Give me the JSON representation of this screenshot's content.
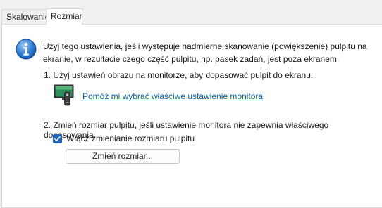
{
  "tabs": [
    {
      "label": "Skalowanie",
      "selected": false
    },
    {
      "label": "Rozmiar",
      "selected": true
    }
  ],
  "intro": {
    "line1": "Użyj tego ustawienia, jeśli występuje nadmierne skanowanie (powiększenie) pulpitu na",
    "line2": "ekranie, w rezultacie czego część pulpitu, np. pasek zadań, jest poza ekranem."
  },
  "step1": {
    "text": "1. Użyj ustawień obrazu na monitorze, aby dopasować pulpit do ekranu.",
    "link": "Pomóż mi wybrać właściwe ustawienie monitora"
  },
  "step2": {
    "text": "2. Zmień rozmiar pulpitu, jeśli ustawienie monitora nie zapewnia właściwego dopasowania.",
    "checkbox_label": "Włącz zmienianie rozmiaru pulpitu",
    "checkbox_checked": true,
    "button_label": "Zmień rozmiar..."
  },
  "icons": {
    "info": "info-icon",
    "monitor": "monitor-remote-icon"
  },
  "colors": {
    "accent": "#1f63b8",
    "link": "#0b5ea5"
  }
}
